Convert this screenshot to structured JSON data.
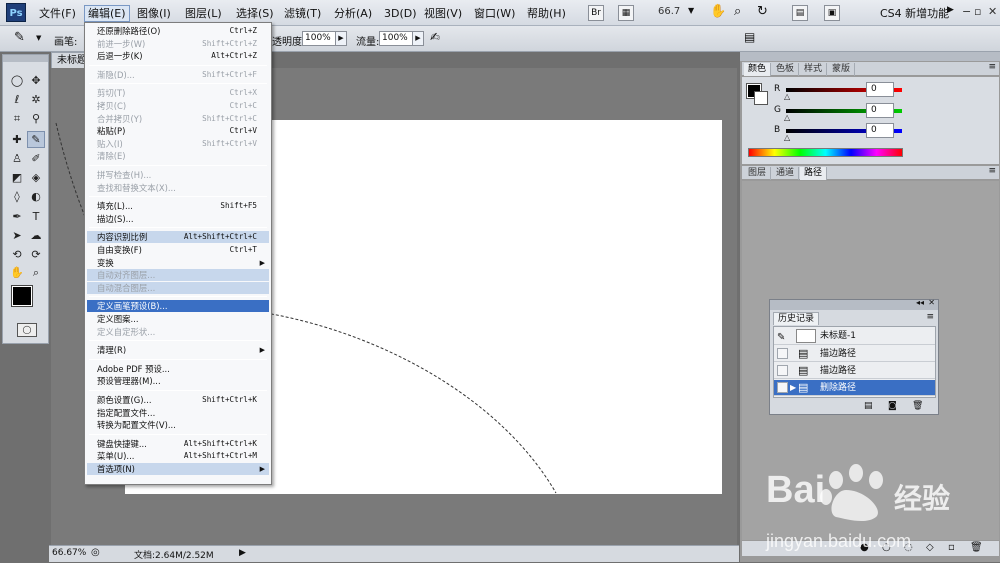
{
  "app": {
    "logo": "Ps"
  },
  "menu": {
    "items": [
      "文件(F)",
      "编辑(E)",
      "图像(I)",
      "图层(L)",
      "选择(S)",
      "滤镜(T)",
      "分析(A)",
      "3D(D)",
      "视图(V)",
      "窗口(W)",
      "帮助(H)"
    ],
    "zoom": "66.7",
    "workspace": "CS4 新增功能",
    "icons": [
      "br-icon",
      "mb-icon",
      "hand-icon",
      "zoom-icon",
      "rotate-icon",
      "arrange-icon",
      "screen-mode-icon"
    ]
  },
  "options": {
    "brush_label": "画笔:",
    "opacity_label": "透明度:",
    "opacity_value": "100%",
    "flow_label": "流量:",
    "flow_value": "100%"
  },
  "document": {
    "tab_title": "未标题",
    "zoom": "66.67%",
    "doc_info": "文档:2.64M/2.52M"
  },
  "edit_menu": {
    "items": [
      {
        "label": "还原删除路径(O)",
        "shortcut": "Ctrl+Z",
        "state": "normal"
      },
      {
        "label": "前进一步(W)",
        "shortcut": "Shift+Ctrl+Z",
        "state": "disabled"
      },
      {
        "label": "后退一步(K)",
        "shortcut": "Alt+Ctrl+Z",
        "state": "normal"
      },
      {
        "sep": true
      },
      {
        "label": "渐隐(D)...",
        "shortcut": "Shift+Ctrl+F",
        "state": "disabled"
      },
      {
        "sep": true
      },
      {
        "label": "剪切(T)",
        "shortcut": "Ctrl+X",
        "state": "disabled"
      },
      {
        "label": "拷贝(C)",
        "shortcut": "Ctrl+C",
        "state": "disabled"
      },
      {
        "label": "合并拷贝(Y)",
        "shortcut": "Shift+Ctrl+C",
        "state": "disabled"
      },
      {
        "label": "粘贴(P)",
        "shortcut": "Ctrl+V",
        "state": "normal"
      },
      {
        "label": "贴入(I)",
        "shortcut": "Shift+Ctrl+V",
        "state": "disabled"
      },
      {
        "label": "清除(E)",
        "shortcut": "",
        "state": "disabled"
      },
      {
        "sep": true
      },
      {
        "label": "拼写检查(H)...",
        "shortcut": "",
        "state": "disabled"
      },
      {
        "label": "查找和替换文本(X)...",
        "shortcut": "",
        "state": "disabled"
      },
      {
        "sep": true
      },
      {
        "label": "填充(L)...",
        "shortcut": "Shift+F5",
        "state": "normal"
      },
      {
        "label": "描边(S)...",
        "shortcut": "",
        "state": "normal"
      },
      {
        "sep": true
      },
      {
        "label": "内容识别比例",
        "shortcut": "Alt+Shift+Ctrl+C",
        "state": "highlight"
      },
      {
        "label": "自由变换(F)",
        "shortcut": "Ctrl+T",
        "state": "normal"
      },
      {
        "label": "变换",
        "shortcut": "",
        "state": "normal",
        "submenu": true
      },
      {
        "label": "自动对齐图层...",
        "shortcut": "",
        "state": "highlight-disabled"
      },
      {
        "label": "自动混合图层...",
        "shortcut": "",
        "state": "highlight-disabled"
      },
      {
        "sep": true
      },
      {
        "label": "定义画笔预设(B)...",
        "shortcut": "",
        "state": "selected"
      },
      {
        "label": "定义图案...",
        "shortcut": "",
        "state": "normal"
      },
      {
        "label": "定义自定形状...",
        "shortcut": "",
        "state": "disabled"
      },
      {
        "sep": true
      },
      {
        "label": "清理(R)",
        "shortcut": "",
        "state": "normal",
        "submenu": true
      },
      {
        "sep": true
      },
      {
        "label": "Adobe PDF 预设...",
        "shortcut": "",
        "state": "normal"
      },
      {
        "label": "预设管理器(M)...",
        "shortcut": "",
        "state": "normal"
      },
      {
        "sep": true
      },
      {
        "label": "颜色设置(G)...",
        "shortcut": "Shift+Ctrl+K",
        "state": "normal"
      },
      {
        "label": "指定配置文件...",
        "shortcut": "",
        "state": "normal"
      },
      {
        "label": "转换为配置文件(V)...",
        "shortcut": "",
        "state": "normal"
      },
      {
        "sep": true
      },
      {
        "label": "键盘快捷键...",
        "shortcut": "Alt+Shift+Ctrl+K",
        "state": "normal"
      },
      {
        "label": "菜单(U)...",
        "shortcut": "Alt+Shift+Ctrl+M",
        "state": "normal"
      },
      {
        "label": "首选项(N)",
        "shortcut": "",
        "state": "highlight",
        "submenu": true
      }
    ]
  },
  "color_panel": {
    "tabs": [
      "颜色",
      "色板",
      "样式",
      "蒙版"
    ],
    "r_label": "R",
    "g_label": "G",
    "b_label": "B",
    "r_value": "0",
    "g_value": "0",
    "b_value": "0"
  },
  "layers_panel": {
    "tabs": [
      "图层",
      "通道",
      "路径"
    ]
  },
  "history_panel": {
    "title": "历史记录",
    "snapshot": "未标题-1",
    "rows": [
      "描边路径",
      "描边路径",
      "删除路径"
    ]
  },
  "watermark": {
    "brand": "Bai",
    "brand2": "经验",
    "url": "jingyan.baidu.com"
  },
  "colors": {
    "selection": "#3a6fc4",
    "hover": "#c7d7ec",
    "fg": "#000000",
    "bg": "#ffffff"
  }
}
